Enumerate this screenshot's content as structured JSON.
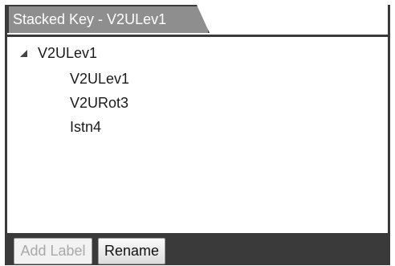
{
  "panel": {
    "tab_title": "Stacked Key - V2ULev1"
  },
  "tree": {
    "root": {
      "label": "V2ULev1",
      "expanded": true,
      "children": [
        {
          "label": "V2ULev1"
        },
        {
          "label": "V2URot3"
        },
        {
          "label": "Istn4"
        }
      ]
    }
  },
  "footer": {
    "add_label_button": "Add Label",
    "add_label_enabled": false,
    "rename_button": "Rename"
  },
  "colors": {
    "frame": "#3a3a3a",
    "tab_background": "#8e8e8e",
    "tab_text": "#ffffff",
    "content_background": "#ffffff",
    "disabled_text": "#a9a9a9"
  },
  "icons": {
    "expander": "expanded-triangle-icon"
  }
}
